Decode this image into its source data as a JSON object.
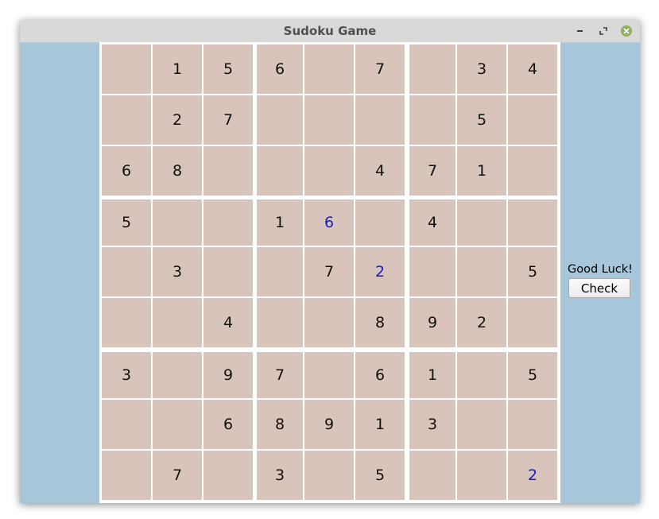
{
  "window": {
    "title": "Sudoku Game",
    "controls": {
      "minimize": "minimize-icon",
      "maximize": "maximize-icon",
      "close": "close-icon"
    }
  },
  "board": {
    "rows": [
      [
        "",
        "1",
        "5",
        "6",
        "",
        "7",
        "",
        "3",
        "4"
      ],
      [
        "",
        "2",
        "7",
        "",
        "",
        "",
        "",
        "5",
        ""
      ],
      [
        "6",
        "8",
        "",
        "",
        "",
        "4",
        "7",
        "1",
        ""
      ],
      [
        "5",
        "",
        "",
        "1",
        "6",
        "",
        "4",
        "",
        ""
      ],
      [
        "",
        "3",
        "",
        "",
        "7",
        "2",
        "",
        "",
        "5"
      ],
      [
        "",
        "",
        "4",
        "",
        "",
        "8",
        "9",
        "2",
        ""
      ],
      [
        "3",
        "",
        "9",
        "7",
        "",
        "6",
        "1",
        "",
        "5"
      ],
      [
        "",
        "",
        "6",
        "8",
        "9",
        "1",
        "3",
        "",
        ""
      ],
      [
        "",
        "7",
        "",
        "3",
        "",
        "5",
        "",
        "",
        "2"
      ]
    ],
    "user_entries": [
      [
        3,
        4
      ],
      [
        4,
        5
      ],
      [
        8,
        8
      ]
    ],
    "colors": {
      "cell": "#d8c4bb",
      "given": "#111111",
      "user": "#1a1acc",
      "background": "#a8c6da"
    }
  },
  "side": {
    "message": "Good Luck!",
    "check_label": "Check"
  }
}
